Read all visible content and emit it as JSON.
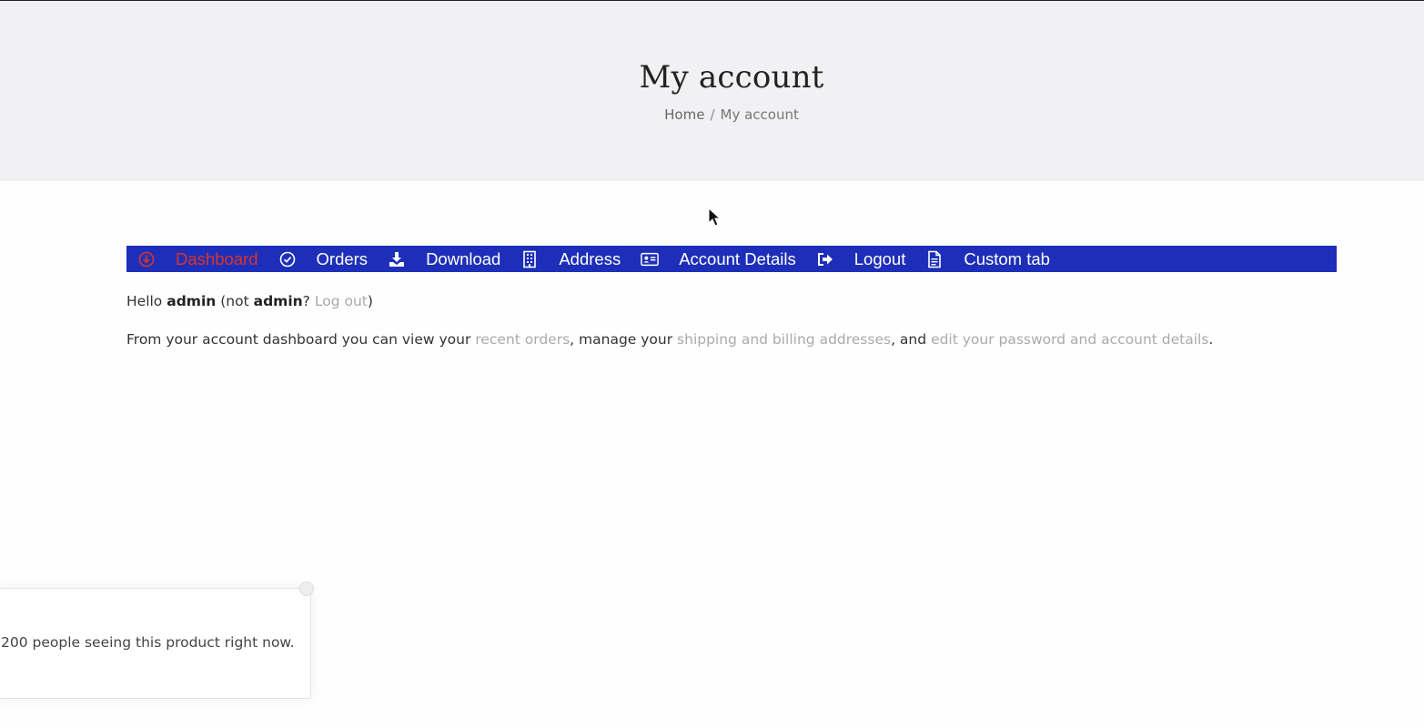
{
  "hero": {
    "title": "My account",
    "breadcrumb": {
      "home": "Home",
      "separator": "/",
      "current": "My account"
    }
  },
  "nav": {
    "bg_color": "#1d2fb8",
    "active_color": "#d9342b",
    "items": [
      {
        "label": "Dashboard",
        "icon": "circle-arrow-down-icon",
        "active": true
      },
      {
        "label": "Orders",
        "icon": "check-circle-icon"
      },
      {
        "label": "Download",
        "icon": "download-icon"
      },
      {
        "label": "Address",
        "icon": "building-icon"
      },
      {
        "label": "Account Details",
        "icon": "id-card-icon"
      },
      {
        "label": "Logout",
        "icon": "sign-out-icon"
      },
      {
        "label": "Custom tab",
        "icon": "file-text-icon"
      }
    ]
  },
  "dashboard": {
    "hello": "Hello",
    "username": "admin",
    "not_open": "(not",
    "not_username": "admin",
    "question": "?",
    "logout_link": "Log out",
    "close_paren": ")",
    "intro": "From your account dashboard you can view your",
    "recent_orders_link": "recent orders",
    "manage": ", manage your",
    "addresses_link": "shipping and billing addresses",
    "and": ", and",
    "account_link": "edit your password and account details",
    "period": "."
  },
  "popup": {
    "text": "200 people seeing this product right now."
  }
}
